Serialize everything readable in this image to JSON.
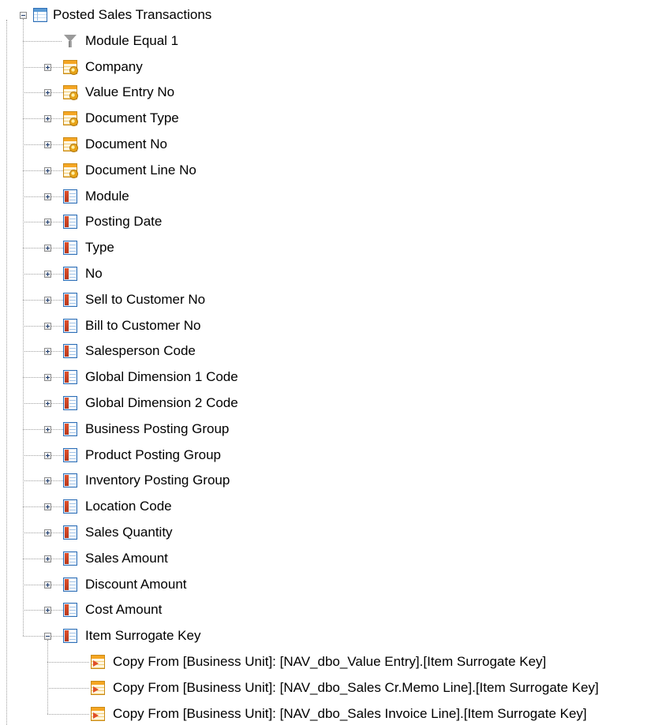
{
  "tree": {
    "root": {
      "label": "Posted Sales Transactions",
      "icon": "table-icon",
      "expanded": true
    },
    "children": [
      {
        "label": "Module Equal 1",
        "icon": "filter-icon",
        "expandable": false
      },
      {
        "label": "Company",
        "icon": "key-attribute-icon",
        "expandable": true,
        "expanded": false
      },
      {
        "label": "Value Entry No",
        "icon": "key-attribute-icon",
        "expandable": true,
        "expanded": false
      },
      {
        "label": "Document Type",
        "icon": "key-attribute-icon",
        "expandable": true,
        "expanded": false
      },
      {
        "label": "Document No",
        "icon": "key-attribute-icon",
        "expandable": true,
        "expanded": false
      },
      {
        "label": "Document Line No",
        "icon": "key-attribute-icon",
        "expandable": true,
        "expanded": false
      },
      {
        "label": "Module",
        "icon": "measure-column-icon",
        "expandable": true,
        "expanded": false
      },
      {
        "label": "Posting Date",
        "icon": "measure-column-icon",
        "expandable": true,
        "expanded": false
      },
      {
        "label": "Type",
        "icon": "measure-column-icon",
        "expandable": true,
        "expanded": false
      },
      {
        "label": "No",
        "icon": "measure-column-icon",
        "expandable": true,
        "expanded": false
      },
      {
        "label": "Sell to Customer No",
        "icon": "measure-column-icon",
        "expandable": true,
        "expanded": false
      },
      {
        "label": "Bill to Customer No",
        "icon": "measure-column-icon",
        "expandable": true,
        "expanded": false
      },
      {
        "label": "Salesperson Code",
        "icon": "measure-column-icon",
        "expandable": true,
        "expanded": false
      },
      {
        "label": "Global Dimension 1 Code",
        "icon": "measure-column-icon",
        "expandable": true,
        "expanded": false
      },
      {
        "label": "Global Dimension 2 Code",
        "icon": "measure-column-icon",
        "expandable": true,
        "expanded": false
      },
      {
        "label": "Business Posting Group",
        "icon": "measure-column-icon",
        "expandable": true,
        "expanded": false
      },
      {
        "label": "Product Posting Group",
        "icon": "measure-column-icon",
        "expandable": true,
        "expanded": false
      },
      {
        "label": "Inventory Posting Group",
        "icon": "measure-column-icon",
        "expandable": true,
        "expanded": false
      },
      {
        "label": "Location Code",
        "icon": "measure-column-icon",
        "expandable": true,
        "expanded": false
      },
      {
        "label": "Sales Quantity",
        "icon": "measure-column-icon",
        "expandable": true,
        "expanded": false
      },
      {
        "label": "Sales Amount",
        "icon": "measure-column-icon",
        "expandable": true,
        "expanded": false
      },
      {
        "label": "Discount Amount",
        "icon": "measure-column-icon",
        "expandable": true,
        "expanded": false
      },
      {
        "label": "Cost Amount",
        "icon": "measure-column-icon",
        "expandable": true,
        "expanded": false
      },
      {
        "label": "Item Surrogate Key",
        "icon": "measure-column-icon",
        "expandable": true,
        "expanded": true,
        "children": [
          {
            "label": "Copy From [Business Unit]: [NAV_dbo_Value Entry].[Item Surrogate Key]",
            "icon": "copy-from-icon"
          },
          {
            "label": "Copy From [Business Unit]: [NAV_dbo_Sales Cr.Memo Line].[Item Surrogate Key]",
            "icon": "copy-from-icon"
          },
          {
            "label": "Copy From [Business Unit]: [NAV_dbo_Sales Invoice Line].[Item Surrogate Key]",
            "icon": "copy-from-icon"
          }
        ]
      }
    ]
  },
  "colors": {
    "tree_line": "#a0a0a0",
    "table_icon_blue": "#5b9bd5",
    "measure_icon_red": "#e0502a",
    "key_icon_orange": "#f5a623"
  }
}
